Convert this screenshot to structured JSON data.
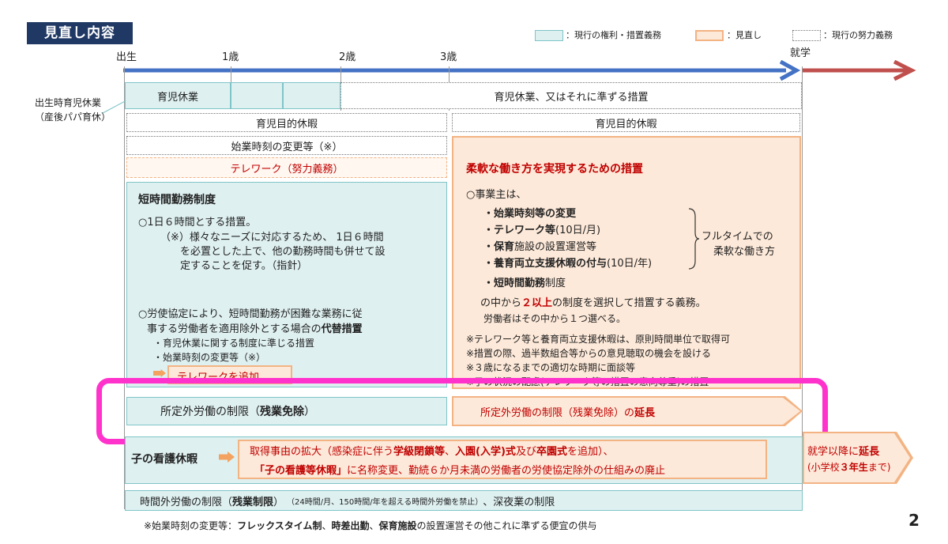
{
  "header": {
    "title": "見直し内容",
    "page_number": "2"
  },
  "legend": {
    "current": "：現行の権利・措置義務",
    "revision": "：見直し",
    "effort": "：現行の努力義務",
    "colors": {
      "current_fill": "#dff0f1",
      "current_border": "#7fc4c8",
      "revision_fill": "#fde9d9",
      "revision_border": "#f3b383"
    }
  },
  "timeline": {
    "birth": "出生",
    "age1": "1歳",
    "age2": "2歳",
    "age3": "3歳",
    "school": "就学",
    "colors": {
      "blue": "#4472c4",
      "red": "#c0504d"
    }
  },
  "leave": {
    "birth_leave": "出生時育児休業",
    "birth_leave_sub": "（産後パパ育休）",
    "childcare_leave": "育児休業",
    "childcare_or_equiv": "育児休業、又はそれに準ずる措置",
    "purpose_leave_left": "育児目的休暇",
    "purpose_leave_right": "育児目的休暇",
    "start_time_change": "始業時刻の変更等（※）",
    "telework_effort": "テレワーク（努力義務）"
  },
  "short_hours": {
    "title": "短時間勤務制度",
    "p1": "○1日６時間とする措置。",
    "p2a": "（※）様々なニーズに対応するため、 1日６時間",
    "p2b": "を必置とした上で、他の勤務時間も併せて設",
    "p2c": "定することを促す。（指針）",
    "p3a": "○労使協定により、短時間勤務が困難な業務に従",
    "p3b_pre": "事する労働者を適用除外とする場合の",
    "p3b_bold": "代替措置",
    "b1": "・育児休業に関する制度に準じる措置",
    "b2": "・始業時刻の変更等（※）",
    "b3": "テレワークを追加"
  },
  "flexible": {
    "title": "柔軟な働き方を実現するための措置",
    "employer": "○事業主は、",
    "i1": "・始業時刻等の変更",
    "i2_bold": "・テレワーク等",
    "i2_rest": "(10日/月)",
    "i3_bold": "・保育",
    "i3_rest": "施設の設置運営等",
    "i4_bold": "・養育両立支援休暇の付与",
    "i4_rest": "(10日/年)",
    "i5_bold": "・短時間勤務",
    "i5_rest": "制度",
    "fulltime_a": "フルタイムでの",
    "fulltime_b": "柔軟な働き方",
    "duty_pre": "の中から",
    "duty_red": "２以上",
    "duty_post": "の制度を選択して措置する義務。",
    "choose": "労働者はその中から１つ選べる。",
    "n1": "※テレワーク等と養育両立支援休暇は、原則時間単位で取得可",
    "n2": "※措置の際、過半数組合等からの意見聴取の機会を設ける",
    "n3": "※３歳になるまでの適切な時期に面談等",
    "n4": "※子の状況の配慮(テレワーク等の措置の意向尊重)の措置"
  },
  "overtime": {
    "left_pre": "所定外労働の制限（",
    "left_bold": "残業免除",
    "left_post": "）",
    "right_pre": "所定外労働の制限（残業免除）の",
    "right_bold": "延長"
  },
  "nursing": {
    "title": "子の看護休暇",
    "l1_pre": "取得事由の拡大（感染症に伴う",
    "l1_b1": "学級閉鎖等",
    "l1_mid": "、",
    "l1_b2": "入園(入学)式",
    "l1_mid2": "及び",
    "l1_b3": "卒園式",
    "l1_post": "を追加）、",
    "l2_red": "「子の看護等休暇」",
    "l2_rest": "に名称変更、勤続６か月未満の労働者の労使協定除外の仕組みの廃止",
    "ext_pre": "就学以降に",
    "ext_bold": "延長",
    "ext2_pre": "(小学校",
    "ext2_bold": "３年生",
    "ext2_post": "まで)"
  },
  "overtime_limit": {
    "pre": "時間外労働の制限（",
    "bold": "残業制限",
    "post": "）",
    "small": "（24時間/月、150時間/年を超える時間外労働を禁止）",
    "tail": "、深夜業の制限"
  },
  "footnote": {
    "pre": "※始業時刻の変更等：",
    "b1": "フレックスタイム制",
    "s1": "、",
    "b2": "時差出勤",
    "s2": "、",
    "b3": "保育施設",
    "post": "の設置運営その他これに準ずる便宜の供与"
  },
  "highlight_color": "#ff33cc"
}
